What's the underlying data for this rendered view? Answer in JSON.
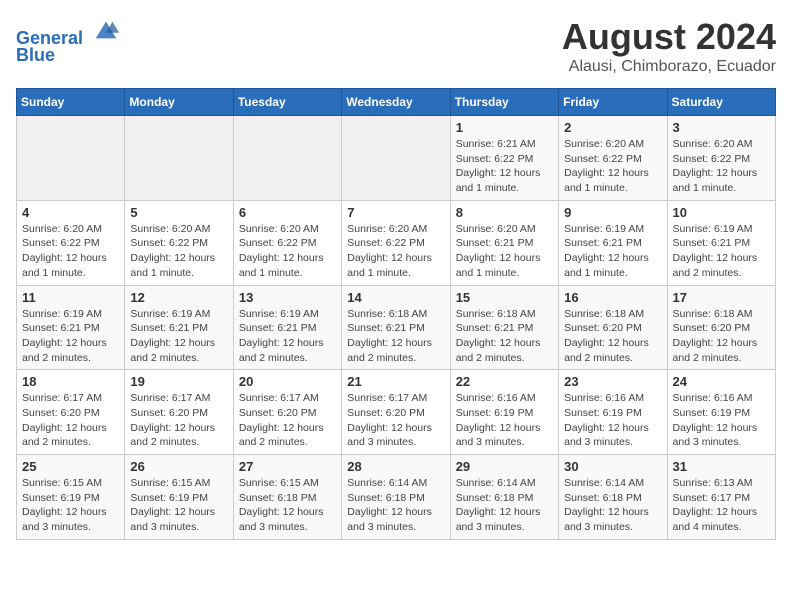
{
  "header": {
    "logo_line1": "General",
    "logo_line2": "Blue",
    "calendar_title": "August 2024",
    "calendar_subtitle": "Alausi, Chimborazo, Ecuador"
  },
  "weekdays": [
    "Sunday",
    "Monday",
    "Tuesday",
    "Wednesday",
    "Thursday",
    "Friday",
    "Saturday"
  ],
  "weeks": [
    [
      {
        "day": "",
        "info": ""
      },
      {
        "day": "",
        "info": ""
      },
      {
        "day": "",
        "info": ""
      },
      {
        "day": "",
        "info": ""
      },
      {
        "day": "1",
        "info": "Sunrise: 6:21 AM\nSunset: 6:22 PM\nDaylight: 12 hours\nand 1 minute."
      },
      {
        "day": "2",
        "info": "Sunrise: 6:20 AM\nSunset: 6:22 PM\nDaylight: 12 hours\nand 1 minute."
      },
      {
        "day": "3",
        "info": "Sunrise: 6:20 AM\nSunset: 6:22 PM\nDaylight: 12 hours\nand 1 minute."
      }
    ],
    [
      {
        "day": "4",
        "info": "Sunrise: 6:20 AM\nSunset: 6:22 PM\nDaylight: 12 hours\nand 1 minute."
      },
      {
        "day": "5",
        "info": "Sunrise: 6:20 AM\nSunset: 6:22 PM\nDaylight: 12 hours\nand 1 minute."
      },
      {
        "day": "6",
        "info": "Sunrise: 6:20 AM\nSunset: 6:22 PM\nDaylight: 12 hours\nand 1 minute."
      },
      {
        "day": "7",
        "info": "Sunrise: 6:20 AM\nSunset: 6:22 PM\nDaylight: 12 hours\nand 1 minute."
      },
      {
        "day": "8",
        "info": "Sunrise: 6:20 AM\nSunset: 6:21 PM\nDaylight: 12 hours\nand 1 minute."
      },
      {
        "day": "9",
        "info": "Sunrise: 6:19 AM\nSunset: 6:21 PM\nDaylight: 12 hours\nand 1 minute."
      },
      {
        "day": "10",
        "info": "Sunrise: 6:19 AM\nSunset: 6:21 PM\nDaylight: 12 hours\nand 2 minutes."
      }
    ],
    [
      {
        "day": "11",
        "info": "Sunrise: 6:19 AM\nSunset: 6:21 PM\nDaylight: 12 hours\nand 2 minutes."
      },
      {
        "day": "12",
        "info": "Sunrise: 6:19 AM\nSunset: 6:21 PM\nDaylight: 12 hours\nand 2 minutes."
      },
      {
        "day": "13",
        "info": "Sunrise: 6:19 AM\nSunset: 6:21 PM\nDaylight: 12 hours\nand 2 minutes."
      },
      {
        "day": "14",
        "info": "Sunrise: 6:18 AM\nSunset: 6:21 PM\nDaylight: 12 hours\nand 2 minutes."
      },
      {
        "day": "15",
        "info": "Sunrise: 6:18 AM\nSunset: 6:21 PM\nDaylight: 12 hours\nand 2 minutes."
      },
      {
        "day": "16",
        "info": "Sunrise: 6:18 AM\nSunset: 6:20 PM\nDaylight: 12 hours\nand 2 minutes."
      },
      {
        "day": "17",
        "info": "Sunrise: 6:18 AM\nSunset: 6:20 PM\nDaylight: 12 hours\nand 2 minutes."
      }
    ],
    [
      {
        "day": "18",
        "info": "Sunrise: 6:17 AM\nSunset: 6:20 PM\nDaylight: 12 hours\nand 2 minutes."
      },
      {
        "day": "19",
        "info": "Sunrise: 6:17 AM\nSunset: 6:20 PM\nDaylight: 12 hours\nand 2 minutes."
      },
      {
        "day": "20",
        "info": "Sunrise: 6:17 AM\nSunset: 6:20 PM\nDaylight: 12 hours\nand 2 minutes."
      },
      {
        "day": "21",
        "info": "Sunrise: 6:17 AM\nSunset: 6:20 PM\nDaylight: 12 hours\nand 3 minutes."
      },
      {
        "day": "22",
        "info": "Sunrise: 6:16 AM\nSunset: 6:19 PM\nDaylight: 12 hours\nand 3 minutes."
      },
      {
        "day": "23",
        "info": "Sunrise: 6:16 AM\nSunset: 6:19 PM\nDaylight: 12 hours\nand 3 minutes."
      },
      {
        "day": "24",
        "info": "Sunrise: 6:16 AM\nSunset: 6:19 PM\nDaylight: 12 hours\nand 3 minutes."
      }
    ],
    [
      {
        "day": "25",
        "info": "Sunrise: 6:15 AM\nSunset: 6:19 PM\nDaylight: 12 hours\nand 3 minutes."
      },
      {
        "day": "26",
        "info": "Sunrise: 6:15 AM\nSunset: 6:19 PM\nDaylight: 12 hours\nand 3 minutes."
      },
      {
        "day": "27",
        "info": "Sunrise: 6:15 AM\nSunset: 6:18 PM\nDaylight: 12 hours\nand 3 minutes."
      },
      {
        "day": "28",
        "info": "Sunrise: 6:14 AM\nSunset: 6:18 PM\nDaylight: 12 hours\nand 3 minutes."
      },
      {
        "day": "29",
        "info": "Sunrise: 6:14 AM\nSunset: 6:18 PM\nDaylight: 12 hours\nand 3 minutes."
      },
      {
        "day": "30",
        "info": "Sunrise: 6:14 AM\nSunset: 6:18 PM\nDaylight: 12 hours\nand 3 minutes."
      },
      {
        "day": "31",
        "info": "Sunrise: 6:13 AM\nSunset: 6:17 PM\nDaylight: 12 hours\nand 4 minutes."
      }
    ]
  ]
}
